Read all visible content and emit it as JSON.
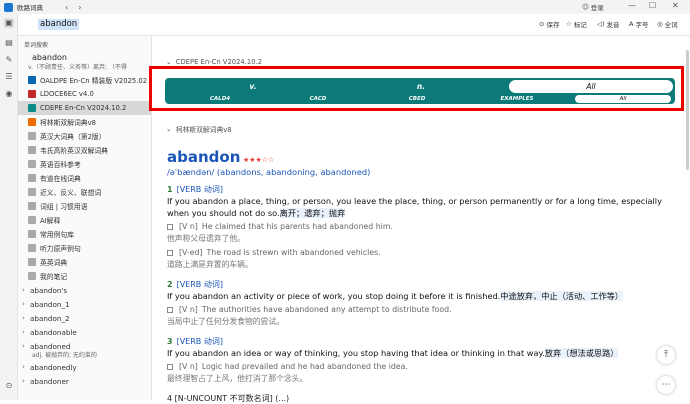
{
  "app": {
    "title": "欧路词典",
    "back": "‹",
    "forward": "›",
    "login": "登录",
    "minimize": "—",
    "maximize": "☐",
    "close": "✕"
  },
  "search": {
    "value": "abandon"
  },
  "toolbar": {
    "save": "保存",
    "mark": "标记",
    "speak": "发音",
    "font": "字号",
    "all": "全词"
  },
  "sidebar": {
    "header": "单词搜索",
    "word": "abandon",
    "def": "v.（不顾责任、义务等）离弃; （不得",
    "dicts": [
      {
        "label": "OALDPE En-Cn 精装版 V2025.02",
        "icon": "blue"
      },
      {
        "label": "LDOCE6EC v4.0",
        "icon": "red"
      },
      {
        "label": "CDEPE En-Cn V2024.10.2",
        "icon": "teal"
      },
      {
        "label": "柯林斯双解词典v8",
        "icon": "orange"
      },
      {
        "label": "英汉大词典（第2版）",
        "icon": "gray"
      },
      {
        "label": "韦氏高阶英汉双解词典",
        "icon": "gray"
      },
      {
        "label": "英语百科参考",
        "icon": "gray"
      },
      {
        "label": "有道在线词典",
        "icon": "gray"
      },
      {
        "label": "近义、反义、联想词",
        "icon": "gray"
      },
      {
        "label": "词组 | 习惯用语",
        "icon": "gray"
      },
      {
        "label": "AI解释",
        "icon": "gray"
      },
      {
        "label": "常用例句库",
        "icon": "gray"
      },
      {
        "label": "听力原声例句",
        "icon": "gray"
      },
      {
        "label": "英英词典",
        "icon": "gray"
      },
      {
        "label": "我的笔记",
        "icon": "gray"
      }
    ],
    "words": [
      {
        "label": "abandon's"
      },
      {
        "label": "abandon_1"
      },
      {
        "label": "abandon_2"
      },
      {
        "label": "abandonable"
      },
      {
        "label": "abandoned",
        "def": "adj. 被抛弃的; 无约束的"
      },
      {
        "label": "abandonedly"
      },
      {
        "label": "abandoner"
      }
    ]
  },
  "cdepe": {
    "header": "CDEPE En-Cn V2024.10.2",
    "top_tabs": [
      "v.",
      "n.",
      "All"
    ],
    "bottom_tabs": [
      "CALD4",
      "CACD",
      "CBED",
      "EXAMPLES",
      "All"
    ]
  },
  "collins": {
    "header": "柯林斯双解词典v8",
    "headword": "abandon",
    "stars": "★★★☆☆",
    "phonetic": "/əˈbændən/ (abandons, abandoning, abandoned)",
    "senses": [
      {
        "num": "1",
        "pos": "[VERB 动词]",
        "def": "If you abandon a place, thing, or person, you leave the place, thing, or person permanently or for a long time, especially when you should not do so.",
        "cn": "离开；遗弃；抛弃",
        "examples": [
          {
            "tag": "[V n]",
            "en": "He claimed that his parents had abandoned him.",
            "cn": "他声称父母遗弃了他。"
          },
          {
            "tag": "[V-ed]",
            "en": "The road is strewn with abandoned vehicles.",
            "cn": "道路上满是弃置的车辆。"
          }
        ]
      },
      {
        "num": "2",
        "pos": "[VERB 动词]",
        "def": "If you abandon an activity or piece of work, you stop doing it before it is finished.",
        "cn": "中途放弃，中止（活动、工作等）",
        "examples": [
          {
            "tag": "[V n]",
            "en": "The authorities have abandoned any attempt to distribute food.",
            "cn": "当局中止了任何分发食物的尝试。"
          }
        ]
      },
      {
        "num": "3",
        "pos": "[VERB 动词]",
        "def": "If you abandon an idea or way of thinking, you stop having that idea or thinking in that way.",
        "cn": "放弃（想法或思路）",
        "examples": [
          {
            "tag": "[V n]",
            "en": "Logic had prevailed and he had abandoned the idea.",
            "cn": "最终理智占了上风，他打消了那个念头。"
          }
        ]
      }
    ],
    "next": "4   [N-UNCOUNT 不可数名词] (...)"
  }
}
